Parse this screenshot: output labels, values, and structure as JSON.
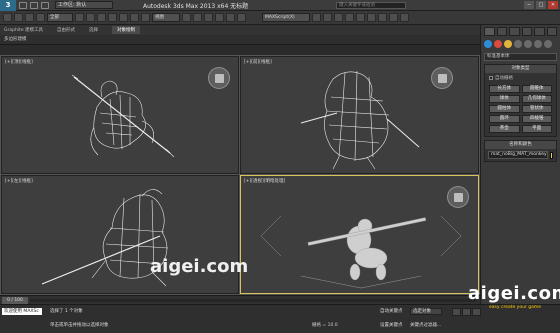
{
  "titlebar": {
    "logo": "3",
    "workspace": "工作区: 默认",
    "title": "Autodesk 3ds Max 2013 x64   无标题",
    "search_placeholder": "键入关键字或短语",
    "buttons": [
      "─",
      "□",
      "✕"
    ]
  },
  "toolbar": {
    "selection_filter": "全部",
    "view_dropdown": "视图",
    "named_selection": "MAXScript(X)"
  },
  "ribbon": {
    "tabs": [
      "Graphite 建模工具",
      "自由形式",
      "选择",
      "对象绘制"
    ],
    "subtitle": "多边形建模"
  },
  "viewports": [
    {
      "label": "[+][顶][线框]"
    },
    {
      "label": "[+][前][线框]"
    },
    {
      "label": "[+][左][线框]"
    },
    {
      "label": "[+][透视][明暗处理]"
    }
  ],
  "command_panel": {
    "category_dropdown": "标准基本体",
    "rollout_object_type": "对象类型",
    "autogrid_label": "自动栅格",
    "object_buttons": [
      "长方体",
      "圆锥体",
      "球体",
      "几何球体",
      "圆柱体",
      "管状体",
      "圆环",
      "四棱锥",
      "茶壶",
      "平面"
    ],
    "rollout_name_color": "名称和颜色",
    "object_name": "mat_noBig_MAT_monkey"
  },
  "timeline": {
    "frame_counter": "0 / 100"
  },
  "statusbar": {
    "maxscript_label": "欢迎使用 MAXSc",
    "selection_status": "选择了 1 个对象",
    "prompt": "单击或单击并拖动以选择对象",
    "grid_label": "栅格 = 10.0",
    "autokey_label": "自动关键点",
    "selected_dropdown": "选定对象",
    "setkey_label": "设置关键点",
    "keyfilter_label": "关键点过滤器..."
  },
  "watermark": {
    "site": "aigei.com",
    "tagline": "easy create your game"
  },
  "colors": {
    "active_viewport_border": "#d9c25a",
    "wireframe": "#ffffff",
    "background": "#3e3e3e"
  }
}
